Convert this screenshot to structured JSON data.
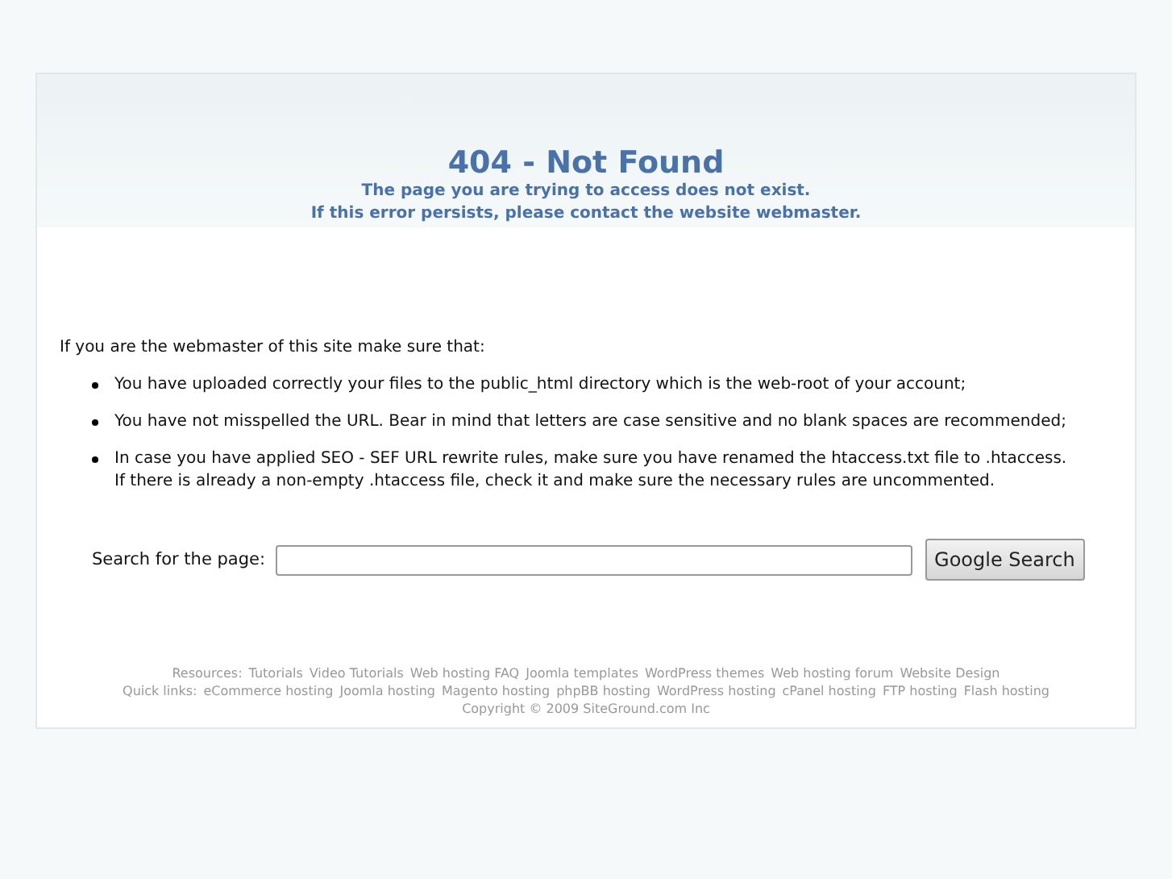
{
  "header": {
    "title": "404 - Not Found",
    "subtitles": [
      "The page you are trying to access does not exist.",
      "If this error persists, please contact the website webmaster."
    ]
  },
  "intro": "If you are the webmaster of this site make sure that:",
  "checklist": [
    {
      "lines": [
        "You have uploaded correctly your files to the public_html directory which is the web-root of your account;"
      ]
    },
    {
      "lines": [
        "You have not misspelled the URL. Bear in mind that letters are case sensitive and no blank spaces are recommended;"
      ]
    },
    {
      "lines": [
        "In case you have applied SEO - SEF URL rewrite rules, make sure you have renamed the htaccess.txt file to .htaccess.",
        "If there is already a non-empty .htaccess file, check it and make sure the necessary rules are uncommented."
      ]
    }
  ],
  "search": {
    "label": "Search for the page:",
    "button": "Google Search"
  },
  "footer": {
    "rows": [
      {
        "prefix": "Resources:",
        "links": [
          "Tutorials",
          "Video Tutorials",
          "Web hosting FAQ",
          "Joomla templates",
          "WordPress themes",
          "Web hosting forum",
          "Website Design"
        ]
      },
      {
        "prefix": "Quick links:",
        "links": [
          "eCommerce hosting",
          "Joomla hosting",
          "Magento hosting",
          "phpBB hosting",
          "WordPress hosting",
          "cPanel hosting",
          "FTP hosting",
          "Flash hosting"
        ]
      }
    ],
    "copyright": "Copyright © 2009 SiteGround.com Inc"
  }
}
